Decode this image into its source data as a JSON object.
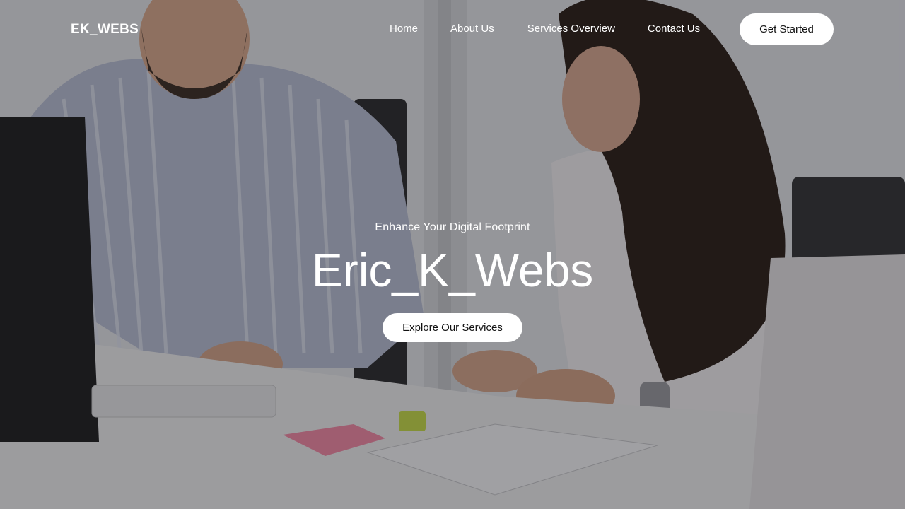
{
  "brand": {
    "logo_text": "EK_WEBS"
  },
  "nav": {
    "links": [
      {
        "label": "Home"
      },
      {
        "label": "About Us"
      },
      {
        "label": "Services Overview"
      },
      {
        "label": "Contact Us"
      }
    ],
    "cta_label": "Get Started"
  },
  "hero": {
    "tagline": "Enhance Your Digital Footprint",
    "title": "Eric_K_Webs",
    "button_label": "Explore Our Services",
    "overlay_color": "#141418"
  }
}
